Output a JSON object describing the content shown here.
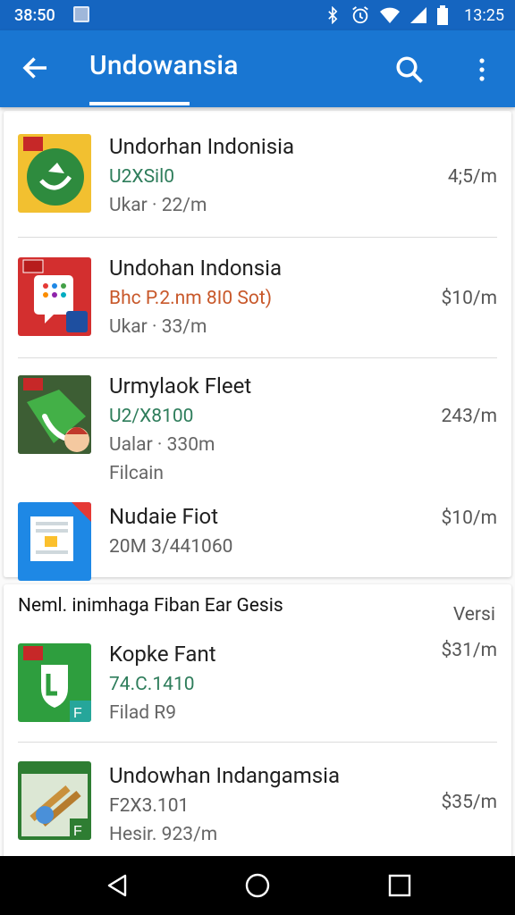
{
  "status_bar": {
    "time_left": "38:50",
    "time_right": "13:25",
    "icons": [
      "bluetooth-icon",
      "alarm-icon",
      "wifi-icon",
      "signal-icon",
      "battery-icon"
    ]
  },
  "app_bar": {
    "title": "Undowansia",
    "back_icon": "arrow-back-icon",
    "search_icon": "search-icon",
    "menu_icon": "more-vert-icon"
  },
  "list_top": [
    {
      "name": "Undorhan Indonisia",
      "sub": "U2XSil0",
      "meta": "Ukar · 22/m",
      "price": "4;5/m",
      "sub_style": "green"
    },
    {
      "name": "Undohan Indonsia",
      "sub": "Bhc P.2.nm 8I0 Sot)",
      "meta": "Ukar · 33/m",
      "price": "$10/m",
      "sub_style": "warn"
    },
    {
      "name": "Urmylaok Fleet",
      "sub": "U2/X8100",
      "meta": "Ualar · 330m",
      "extra": "Filcain",
      "price": "243/m",
      "sub_style": "green"
    },
    {
      "name": "Nudaie Fiot",
      "sub": "20M 3/441060",
      "price": "$10/m",
      "sub_style": "gray"
    }
  ],
  "section": {
    "title": "Neml. inimhaga Fiban Ear Gesis",
    "action": "Versi"
  },
  "list_bottom": [
    {
      "name": "Kopke Fant",
      "sub": "74.C.1410",
      "meta": "Filad R9",
      "price": "$31/m",
      "sub_style": "green"
    },
    {
      "name": "Undowhan Indangamsia",
      "sub": "F2X3.101",
      "meta": "Hesir. 923/m",
      "price": "$35/m",
      "sub_style": "gray"
    }
  ],
  "colors": {
    "status_bar": "#1565c0",
    "app_bar": "#1976d2",
    "accent_green": "#2e7d5b",
    "accent_warn": "#c8582a"
  },
  "nav_bar": {
    "back": "nav-back-icon",
    "home": "nav-home-icon",
    "recents": "nav-recents-icon"
  }
}
